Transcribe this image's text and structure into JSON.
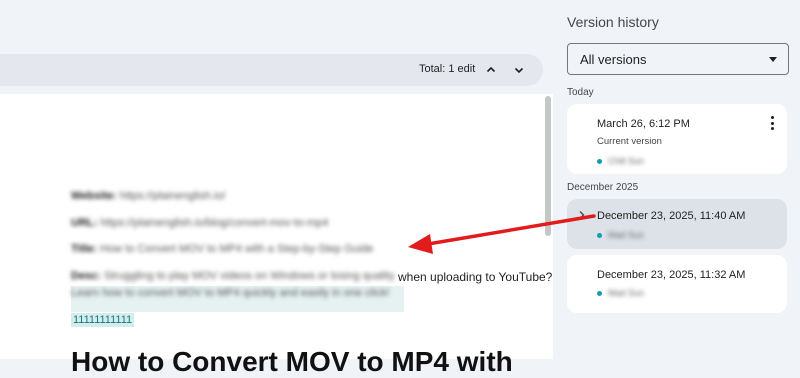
{
  "edit_bar": {
    "total": "Total: 1 edit"
  },
  "document": {
    "website_label": "Website:",
    "website_value": "https://plainenglish.io/",
    "url_label": "URL:",
    "url_value": "https://plainenglish.io/blog/convert-mov-to-mp4",
    "title_label": "Title:",
    "title_value": "How to Convert MOV to MP4 with a Step-by-Step Guide",
    "desc_label": "Desc:",
    "desc_value_blurred": "Struggling to play MOV videos on Windows or losing quality",
    "desc_value_clear": "when uploading to YouTube?",
    "desc_line2": "Learn how to convert MOV to MP4 quickly and easily in one click!",
    "highlight_text": "11111111111",
    "heading": "How to Convert MOV to MP4 with"
  },
  "panel": {
    "title": "Version history",
    "filter_selected": "All versions",
    "groups": {
      "today": "Today",
      "december": "December 2025"
    },
    "versions": [
      {
        "time": "March 26, 6:12 PM",
        "sub": "Current version",
        "author": "Chill Sun"
      },
      {
        "time": "December 23, 2025, 11:40 AM",
        "author": "Mad Sun"
      },
      {
        "time": "December 23, 2025, 11:32 AM",
        "author": "Mad Sun"
      }
    ]
  },
  "colors": {
    "arrow": "#e21c1c",
    "author_dot": "#129eaf",
    "highlight": "#d6ecec"
  },
  "icons": {
    "prev_edit": "chevron-up-icon",
    "next_edit": "chevron-down-icon",
    "dropdown": "caret-down-icon",
    "more": "more-vert-icon",
    "expand": "chevron-right-icon"
  }
}
